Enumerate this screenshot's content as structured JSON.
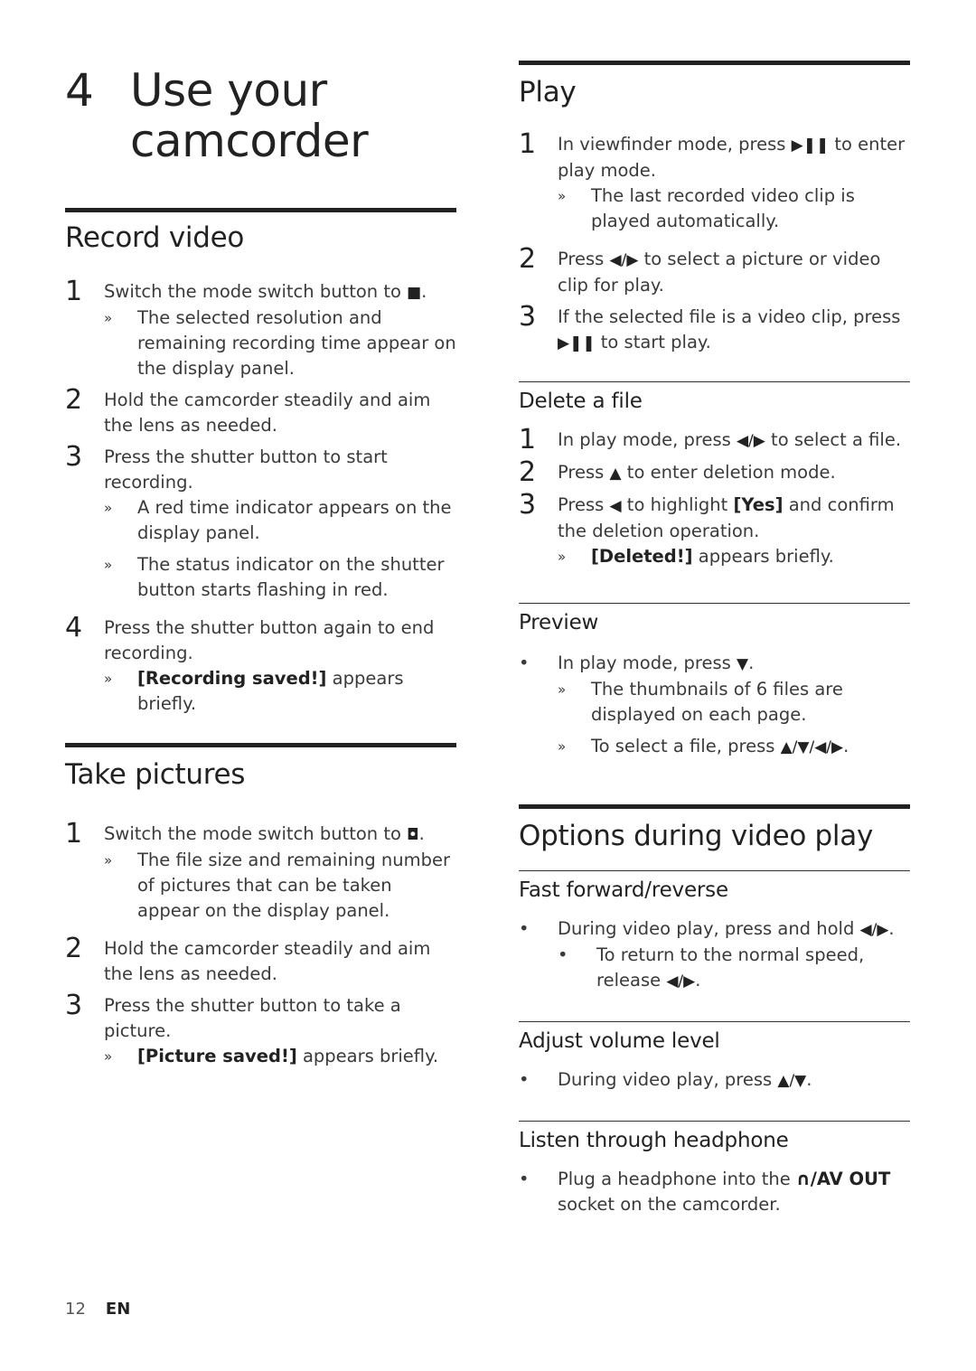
{
  "chapter": {
    "number": "4",
    "title": "Use your camcorder"
  },
  "record_video": {
    "heading": "Record video",
    "steps": [
      {
        "n": "1",
        "pre": "Switch the mode switch button to ",
        "icon": "video-camera-icon",
        "post": ".",
        "results": [
          "The selected resolution and remaining recording time appear on the display panel."
        ]
      },
      {
        "n": "2",
        "text": "Hold the camcorder steadily and aim the lens as needed."
      },
      {
        "n": "3",
        "text": "Press the shutter button to start recording.",
        "results": [
          "A red time indicator appears on the display panel.",
          "The status indicator on the shutter button starts flashing in red."
        ]
      },
      {
        "n": "4",
        "text": "Press the shutter button again to end recording.",
        "result_bold": "[Recording saved!]",
        "result_rest": " appears briefly."
      }
    ]
  },
  "take_pictures": {
    "heading": "Take pictures",
    "steps": [
      {
        "n": "1",
        "pre": "Switch the mode switch button to ",
        "icon": "camera-icon",
        "post": ".",
        "results": [
          "The file size and remaining number of pictures that can be taken appear on the display panel."
        ]
      },
      {
        "n": "2",
        "text": "Hold the camcorder steadily and aim the lens as needed."
      },
      {
        "n": "3",
        "text": "Press the shutter button to take a picture.",
        "result_bold": "[Picture saved!]",
        "result_rest": " appears briefly."
      }
    ]
  },
  "play": {
    "heading": "Play",
    "steps": [
      {
        "n": "1",
        "pre": "In viewfinder mode, press ",
        "icon": "play-pause-icon",
        "post": " to enter play mode.",
        "results": [
          "The last recorded video clip is played automatically."
        ]
      },
      {
        "n": "2",
        "pre": "Press ",
        "icon": "left-right-icon",
        "post": " to select a picture or video clip for play."
      },
      {
        "n": "3",
        "pre": "If the selected file is a video clip, press ",
        "icon": "play-pause-icon",
        "post": " to start play."
      }
    ]
  },
  "delete_file": {
    "heading": "Delete a file",
    "steps": [
      {
        "n": "1",
        "pre": "In play mode, press ",
        "icon": "left-right-icon",
        "post": " to select a file."
      },
      {
        "n": "2",
        "pre": "Press ",
        "icon": "up-icon",
        "post": " to enter deletion mode."
      },
      {
        "n": "3",
        "pre": "Press ",
        "icon": "left-icon",
        "mid": " to highlight ",
        "bold": "[Yes]",
        "post": " and confirm the deletion operation.",
        "result_bold": "[Deleted!]",
        "result_rest": " appears briefly."
      }
    ]
  },
  "preview": {
    "heading": "Preview",
    "bullet_pre": "In play mode, press ",
    "bullet_icon": "down-icon",
    "bullet_post": ".",
    "results": [
      "The thumbnails of 6 files are displayed on each page.",
      "To select a file, press "
    ],
    "result2_icons": "up-down-left-right-icon"
  },
  "options": {
    "heading": "Options during video play",
    "fast_forward": {
      "heading": "Fast forward/reverse",
      "bullet_pre": "During video play, press and hold ",
      "bullet_post": ".",
      "sub_pre": "To return to the normal speed, release ",
      "sub_post": "."
    },
    "volume": {
      "heading": "Adjust volume level",
      "bullet_pre": "During video play, press ",
      "bullet_post": "."
    },
    "headphone": {
      "heading": "Listen through headphone",
      "bullet_pre": "Plug a headphone into the ",
      "socket_label": "/AV OUT",
      "bullet_post": " socket on the camcorder."
    }
  },
  "glyphs": {
    "raquo": "»",
    "bullet": "•",
    "play_pause": "▶❚❚",
    "left_right": "◀/▶",
    "up": "▲",
    "down": "▼",
    "left": "◀",
    "up_down": "▲/▼",
    "up_down_left_right": "▲/▼/◀/▶",
    "video_camera": "🎥",
    "camera": "📷",
    "headphone": "🎧"
  },
  "footer": {
    "page": "12",
    "lang": "EN"
  }
}
